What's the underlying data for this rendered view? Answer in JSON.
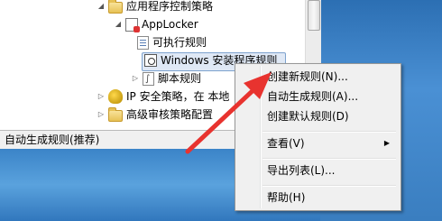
{
  "tree": {
    "items": [
      {
        "label": "应用程序控制策略",
        "icon": "folder-icon",
        "expanded": true
      },
      {
        "label": "AppLocker",
        "icon": "applocker-icon",
        "expanded": true
      },
      {
        "label": "可执行规则",
        "icon": "executable-rules-icon"
      },
      {
        "label": "Windows 安装程序规则",
        "icon": "installer-rules-icon",
        "selected": true
      },
      {
        "label": "脚本规则",
        "icon": "script-rules-icon",
        "expanded": false
      },
      {
        "label": "IP 安全策略，在 本地",
        "icon": "ip-security-icon",
        "expanded": false
      },
      {
        "label": "高级审核策略配置",
        "icon": "folder-icon",
        "expanded": false
      }
    ]
  },
  "status": {
    "text": "自动生成规则(推荐)"
  },
  "context_menu": {
    "items": [
      {
        "label": "创建新规则(N)..."
      },
      {
        "label": "自动生成规则(A)..."
      },
      {
        "label": "创建默认规则(D)"
      },
      {
        "label": "查看(V)",
        "has_submenu": true
      },
      {
        "label": "导出列表(L)..."
      },
      {
        "label": "帮助(H)"
      }
    ]
  },
  "colors": {
    "selection_bg": "#dfe8f5",
    "selection_border": "#7da2ce",
    "annotation_arrow": "#e8332f",
    "desktop_blue": "#3a7ec0"
  }
}
